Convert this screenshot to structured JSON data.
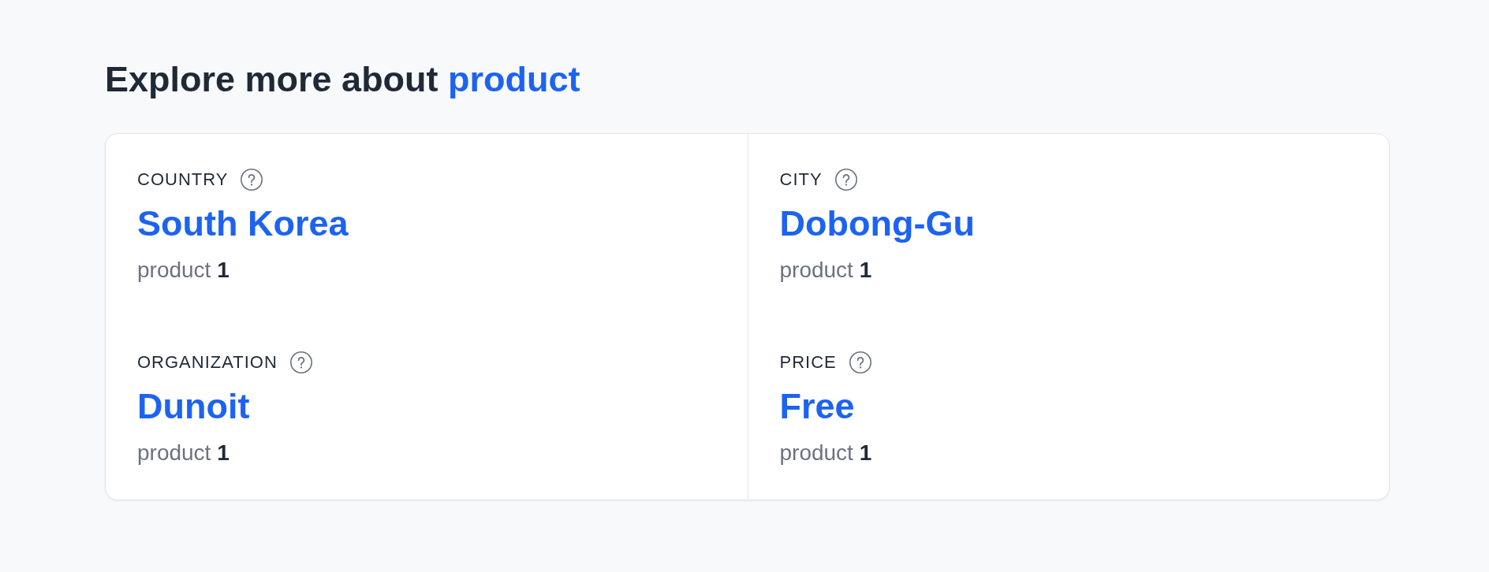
{
  "heading": {
    "text": "Explore more about",
    "highlight": "product"
  },
  "facets": [
    {
      "label": "COUNTRY",
      "value": "South Korea",
      "count": "product **1**"
    },
    {
      "label": "CITY",
      "value": "Dobong-Gu",
      "count": "product **1**"
    },
    {
      "label": "ORGANIZATION",
      "value": "Dunoit",
      "count": "product **1**"
    },
    {
      "label": "PRICE",
      "value": "Free",
      "count": "product **1**"
    }
  ]
}
